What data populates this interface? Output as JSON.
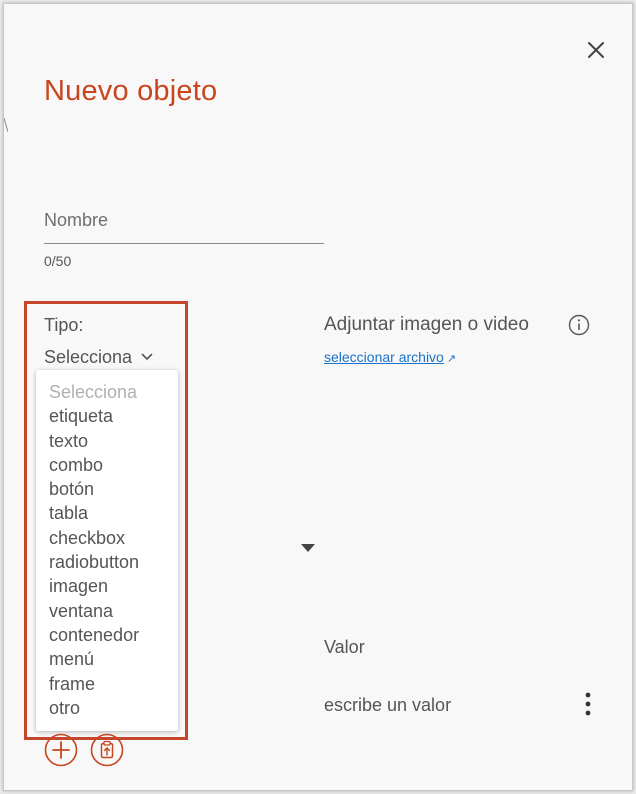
{
  "dialog": {
    "title": "Nuevo objeto",
    "close_icon": "close-icon"
  },
  "name_field": {
    "placeholder": "Nombre",
    "value": "",
    "counter": "0/50"
  },
  "tipo": {
    "label": "Tipo:",
    "selected": "Selecciona",
    "options": [
      "Selecciona",
      "etiqueta",
      "texto",
      "combo",
      "botón",
      "tabla",
      "checkbox",
      "radiobutton",
      "imagen",
      "ventana",
      "contenedor",
      "menú",
      "frame",
      "otro"
    ]
  },
  "attachment": {
    "label": "Adjuntar imagen o video",
    "link": "seleccionar archivo",
    "link_icon": "↗",
    "info_icon": "info-icon"
  },
  "valor": {
    "label": "Valor",
    "placeholder": "escribe un valor",
    "more_icon": "more-vertical-icon"
  },
  "actions": {
    "add_icon": "plus-circle-icon",
    "paste_icon": "clipboard-upload-icon"
  },
  "colors": {
    "accent": "#c8461f",
    "highlight": "#c4472c",
    "link": "#1a73c8",
    "text": "#555555"
  }
}
